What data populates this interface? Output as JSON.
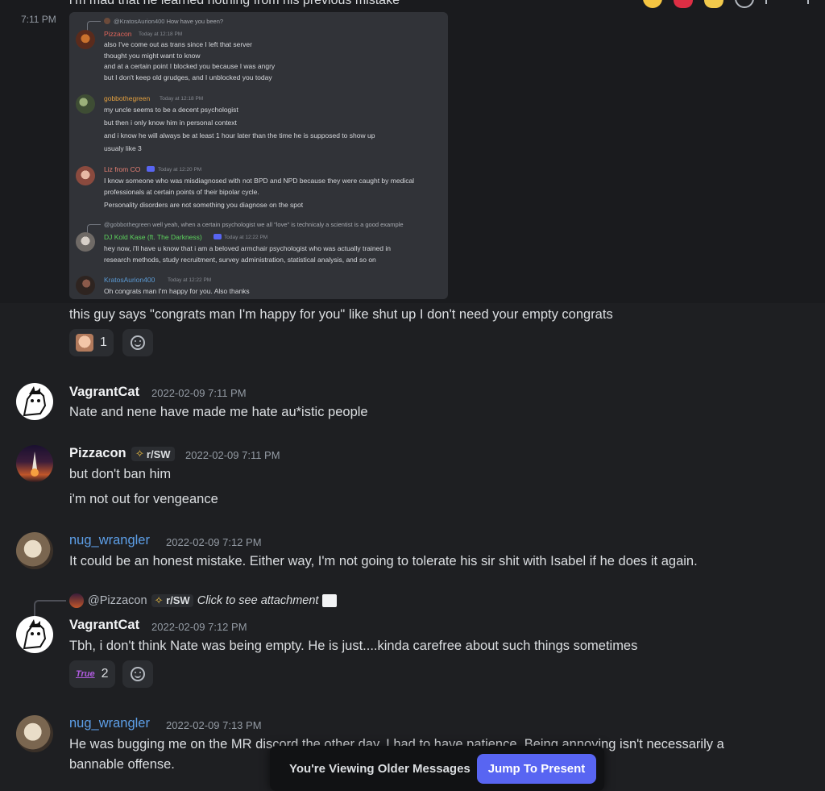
{
  "top_cut_text": "i’m mad that he learned nothing from his previous mistake",
  "first_timestamp": "7:11 PM",
  "attachment": {
    "reply1": {
      "prefix": "@KratosAurion400",
      "text": "How have you been?"
    },
    "msg1": {
      "name": "Pizzacon",
      "time": "Today at 12:18 PM",
      "lines": [
        "also I've come out as trans since I left that server",
        "thought you might want to know",
        "and at a certain point I blocked you because I was angry",
        "but I don't keep old grudges, and I unblocked you today"
      ]
    },
    "msg2": {
      "name": "gobbothegreen",
      "time": "Today at 12:18 PM",
      "lines": [
        "my uncle seems to be a decent psychologist",
        "but then i only know him in personal context",
        "and i know he will always be at least 1 hour later than the time he is supposed to show up",
        "usualy like 3"
      ]
    },
    "msg3": {
      "name": "Liz from CO",
      "time": "Today at 12:20 PM",
      "lines": [
        "I know someone who was misdiagnosed with not BPD and NPD because they were caught by medical",
        "professionals at certain points of their bipolar cycle.",
        "Personality disorders are not something you diagnose on the spot"
      ]
    },
    "reply2": {
      "prefix": "@gobbothegreen",
      "text": "well yeah, when a certain psychologist we all \"love\" is technicaly a scientist is a good example"
    },
    "msg4": {
      "name": "DJ Kold Kase (ft. The Darkness)",
      "time": "Today at 12:22 PM",
      "lines": [
        "hey now, i'll have u know that i am a beloved armchair psychologist who was actually trained in",
        "research methods, study recruitment, survey administration, statistical analysis, and so on"
      ]
    },
    "msg5": {
      "name": "KratosAurion400",
      "time": "Today at 12:22 PM",
      "lines": [
        "Oh congrats man I'm happy for you. Also thanks"
      ]
    }
  },
  "m1": {
    "text": "this guy says \"congrats man I'm happy for you\" like shut up I don't need your empty congrats",
    "reaction_count": "1"
  },
  "m2": {
    "username": "VagrantCat",
    "timestamp": "2022-02-09 7:11 PM",
    "text": "Nate and nene have made me hate au*istic people"
  },
  "m3": {
    "username": "Pizzacon",
    "tag": "r/SW",
    "timestamp": "2022-02-09 7:11 PM",
    "line1": "but don't ban him",
    "line2": "i'm not out for vengeance"
  },
  "m4": {
    "username": "nug_wrangler",
    "timestamp": "2022-02-09 7:12 PM",
    "text": "It could be an honest mistake. Either way, I'm not going to tolerate his sir shit with Isabel if he does it again."
  },
  "m5": {
    "reply_user": "@Pizzacon",
    "reply_tag": "r/SW",
    "reply_text": "Click to see attachment",
    "username": "VagrantCat",
    "timestamp": "2022-02-09 7:12 PM",
    "text": "Tbh, i don't think Nate was being empty. He is just....kinda carefree about such things sometimes",
    "reaction_count": "2",
    "reaction_label": "True"
  },
  "m6": {
    "username": "nug_wrangler",
    "timestamp": "2022-02-09 7:13 PM",
    "line1": "He was bugging me on the MR discord the other day. I had to have patience. Being annoying isn't necessarily a",
    "line2": "bannable offense."
  },
  "older_bar": {
    "text": "You're Viewing Older Messages",
    "button": "Jump To Present"
  },
  "colors": {
    "vagrantcat": "#f2f3f5",
    "pizzacon": "#f2f3f5",
    "nug_wrangler": "#5d9fe8",
    "blurple": "#5865f2",
    "a_pizzacon": "#e0655a",
    "a_gobbo": "#e3a03f",
    "a_liz": "#e57f73",
    "a_dj": "#5dd35d",
    "a_kratos": "#5b9bd5"
  }
}
